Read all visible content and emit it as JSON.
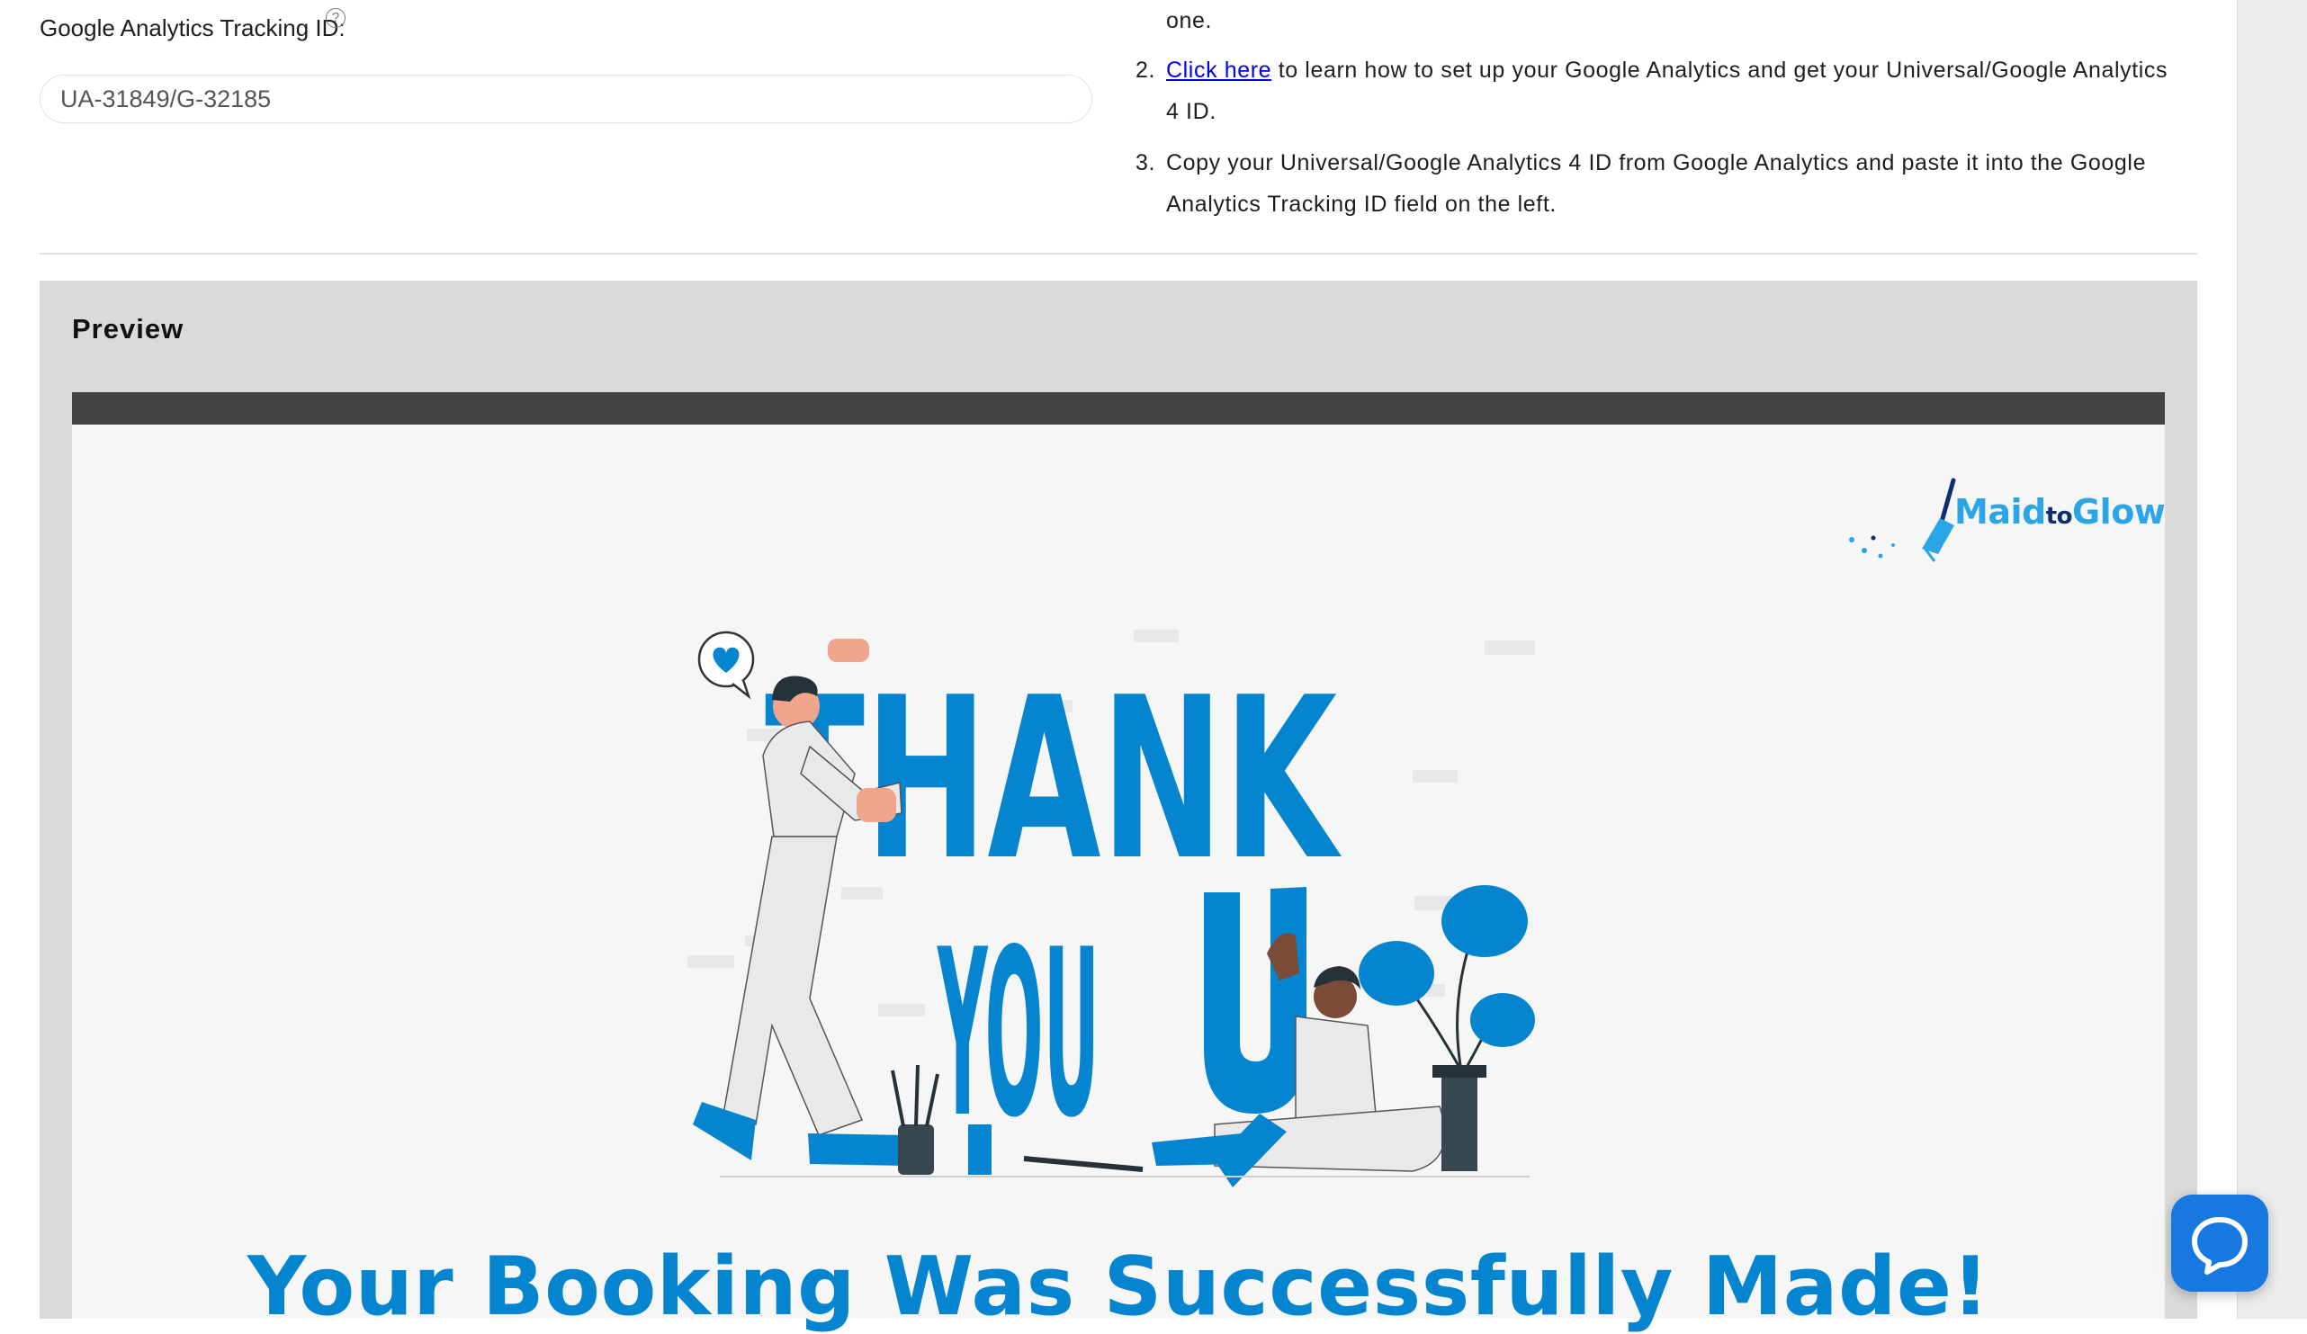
{
  "tracking": {
    "label": "Google Analytics Tracking ID:",
    "help_icon": "?",
    "value": "UA-31849/G-32185"
  },
  "instructions": {
    "step1_tail": "one.",
    "step2_number": "2.",
    "step2_link": "Click here",
    "step2_text_line1": " to learn how to set up your Google Analytics and get your Universal/Google Analytics",
    "step2_text_line2": "4 ID.",
    "step3_number": "3.",
    "step3_text_line1": "Copy your Universal/Google Analytics 4 ID from Google Analytics and paste it into the Google",
    "step3_text_line2": "Analytics Tracking ID field on the left."
  },
  "preview": {
    "title": "Preview",
    "logo_part1": "Maid",
    "logo_part2": "to",
    "logo_part3": "Glow",
    "illustration_text_top": "THANK",
    "illustration_text_bottom": "YOU",
    "success_heading": "Your Booking Was Successfully Made!"
  },
  "colors": {
    "accent_blue": "#0585cf",
    "link": "#0000ee",
    "chat_button": "#1778e0",
    "logo_dark": "#0d2f72"
  },
  "icons": {
    "help": "question-circle-icon",
    "chat": "chat-bubble-icon",
    "logo": "broom-logo-icon",
    "heart": "heart-bubble-icon"
  }
}
